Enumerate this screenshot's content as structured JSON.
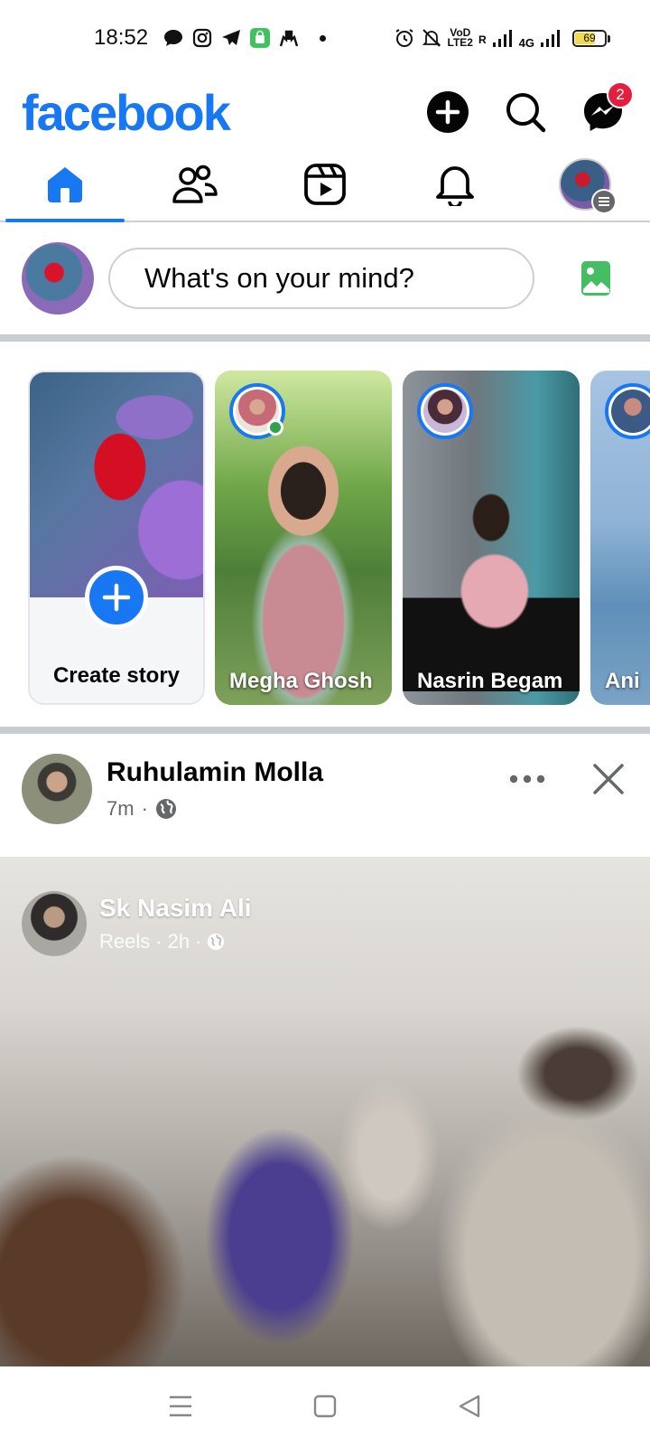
{
  "status_bar": {
    "time": "18:52",
    "network_top": "VoD",
    "network_bottom": "LTE2",
    "roaming": "R",
    "net_type": "4G",
    "battery": "69",
    "battery_level_pct": 69,
    "icons": [
      "chat-bubble-icon",
      "instagram-icon",
      "telegram-icon",
      "shopping-bag-icon",
      "hands-icon",
      "alarm-icon",
      "bell-off-icon",
      "signal-icon"
    ]
  },
  "header": {
    "logo": "facebook",
    "messenger_badge": "2"
  },
  "tabs": [
    {
      "name": "home",
      "active": true
    },
    {
      "name": "friends",
      "active": false
    },
    {
      "name": "reels",
      "active": false
    },
    {
      "name": "notifications",
      "active": false
    },
    {
      "name": "menu",
      "active": false
    }
  ],
  "composer": {
    "placeholder": "What's on your mind?"
  },
  "stories": {
    "create_label": "Create story",
    "items": [
      {
        "name": "Megha Ghosh"
      },
      {
        "name": "Nasrin Begam"
      },
      {
        "name": "Ani"
      }
    ]
  },
  "post": {
    "author": "Ruhulamin Molla",
    "time": "7m",
    "shared": {
      "author": "Sk Nasim Ali",
      "source": "Reels",
      "time": "2h"
    }
  },
  "colors": {
    "brand": "#1877f2",
    "badge": "#e41e3f",
    "online": "#31a24c"
  }
}
